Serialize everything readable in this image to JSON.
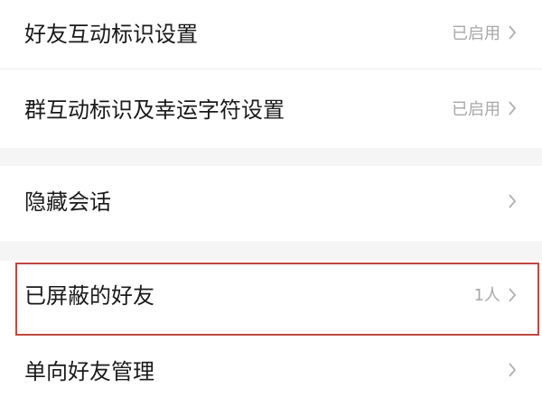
{
  "settings": {
    "items": [
      {
        "label": "好友互动标识设置",
        "value": "已启用"
      },
      {
        "label": "群互动标识及幸运字符设置",
        "value": "已启用"
      },
      {
        "label": "隐藏会话",
        "value": ""
      },
      {
        "label": "已屏蔽的好友",
        "value": "1人"
      },
      {
        "label": "单向好友管理",
        "value": ""
      }
    ]
  },
  "colors": {
    "highlight_border": "#c0483e",
    "section_gap": "#f5f5f5",
    "secondary_text": "#a8a8a8"
  }
}
